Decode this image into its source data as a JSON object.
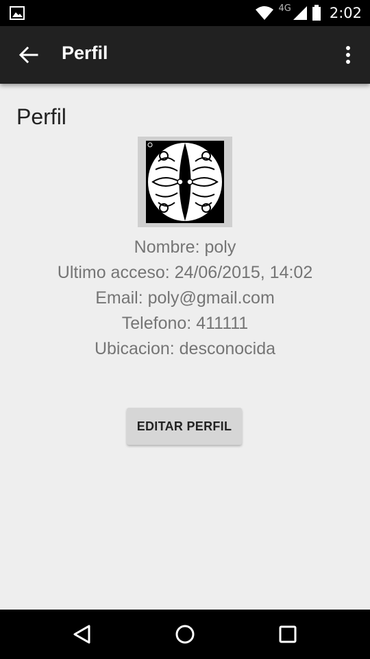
{
  "status_bar": {
    "network": "4G",
    "time": "2:02",
    "icons": [
      "image-icon",
      "wifi-icon",
      "signal-icon",
      "battery-icon"
    ]
  },
  "toolbar": {
    "title": "Perfil",
    "back_icon": "arrow-back-icon",
    "menu_icon": "more-vert-icon"
  },
  "profile": {
    "heading": "Perfil",
    "avatar_icon": "crest-icon",
    "name_line": "Nombre: poly",
    "last_access_line": "Ultimo acceso: 24/06/2015, 14:02",
    "email_line": "Email: poly@gmail.com",
    "phone_line": "Telefono: 411111",
    "location_line": "Ubicacion: desconocida",
    "edit_button": "EDITAR PERFIL"
  },
  "nav_bar": {
    "icons": [
      "back-triangle-icon",
      "home-circle-icon",
      "recents-square-icon"
    ]
  },
  "colors": {
    "status_bar": "#000000",
    "toolbar": "#212121",
    "background": "#eeeeee",
    "text_secondary": "#757575",
    "button": "#d6d6d6"
  }
}
